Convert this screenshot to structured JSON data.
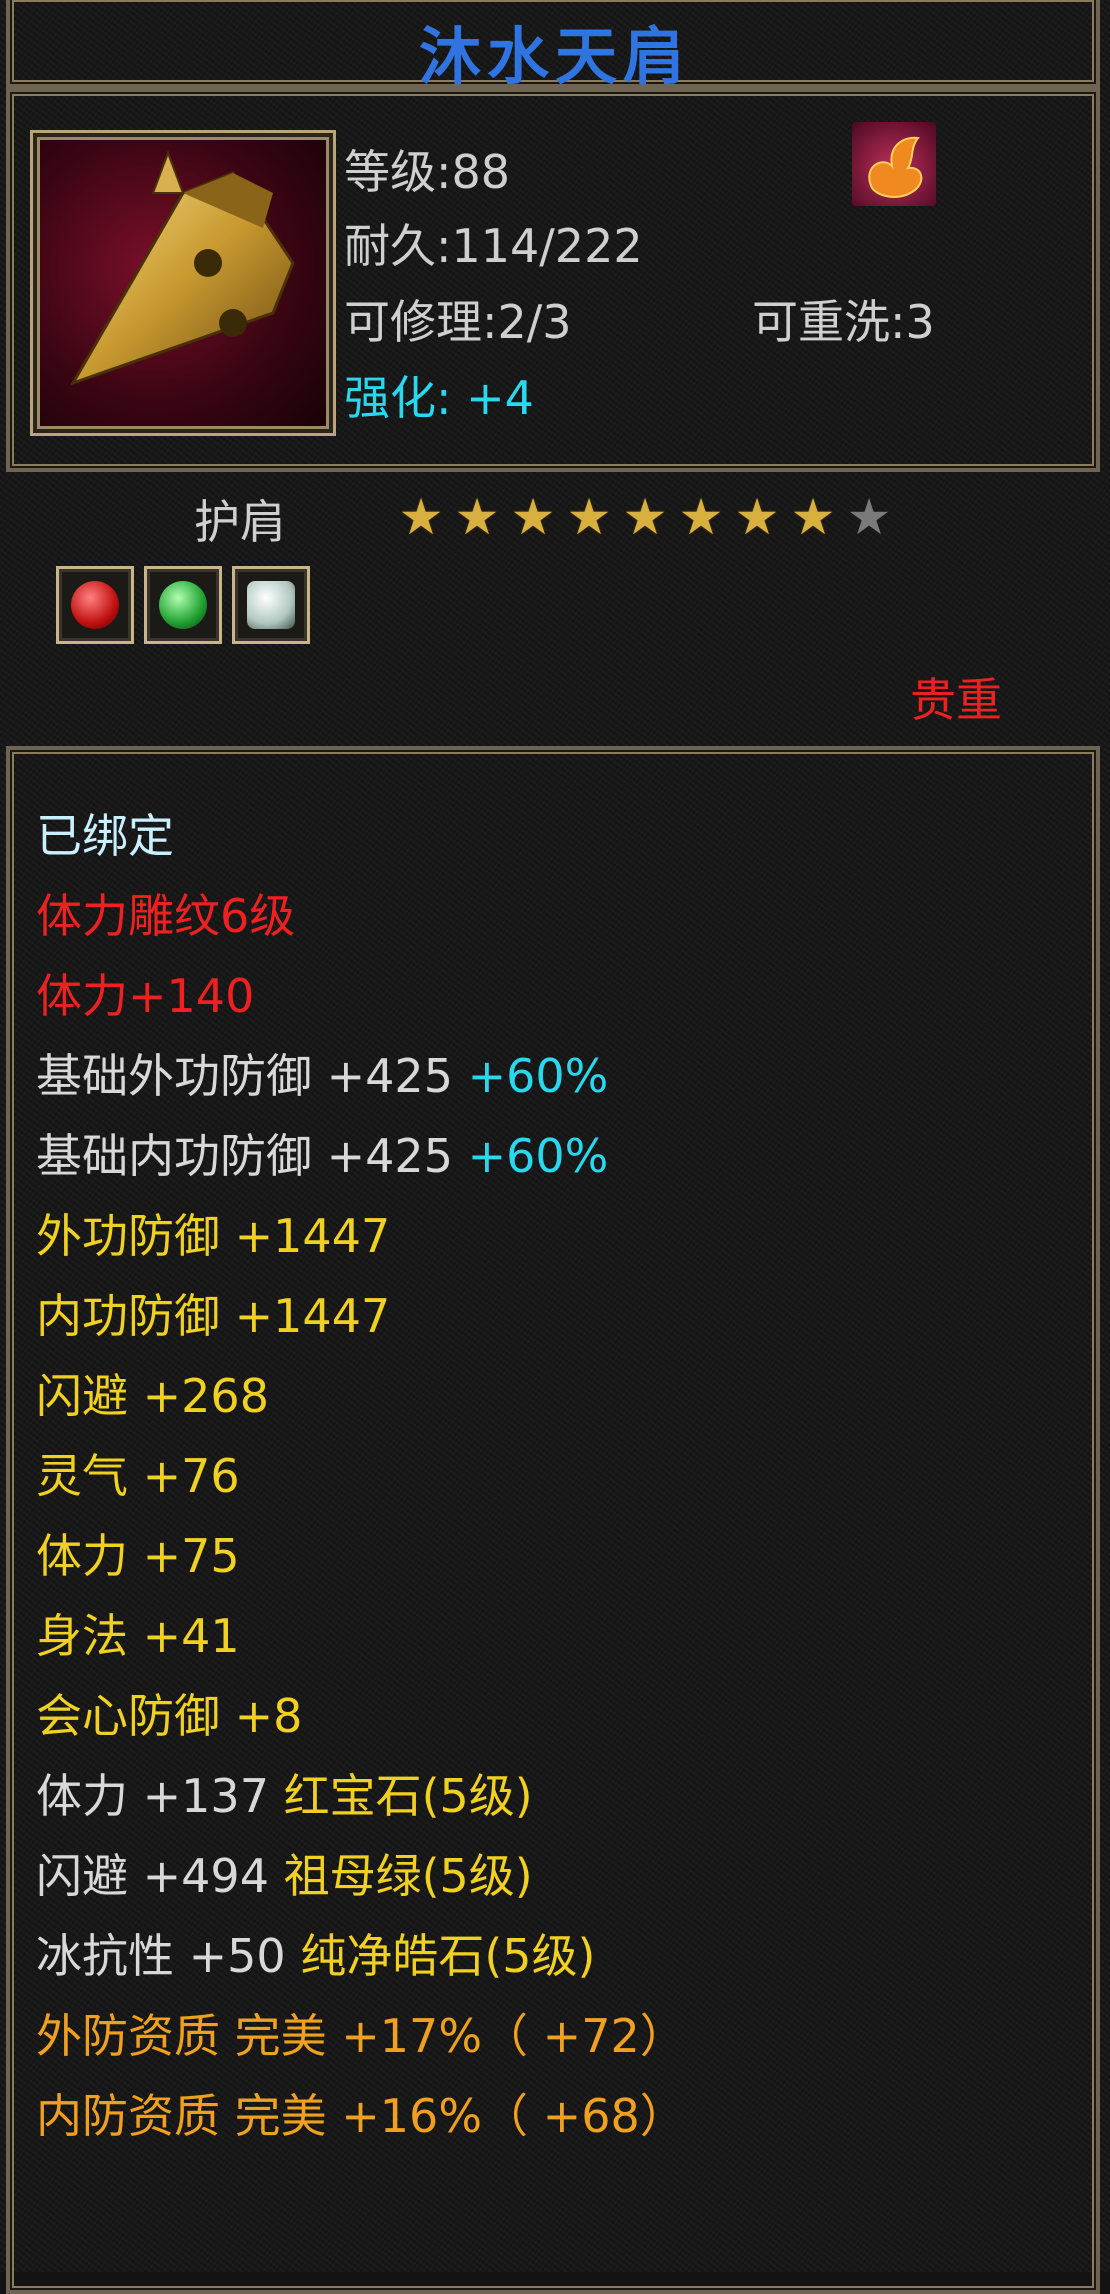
{
  "title": "沐水天肩",
  "info": {
    "level": "等级:88",
    "durability": "耐久:114/222",
    "repairable": "可修理:2/3",
    "rewashable": "可重洗:3",
    "enhance_label": "强化:",
    "enhance_value": "+4"
  },
  "item_type": "护肩",
  "stars": {
    "total": 9,
    "filled": 8
  },
  "rarity": "贵重",
  "gem_icons": [
    "ruby-gem",
    "emerald-gem",
    "diamond-gem"
  ],
  "colors": {
    "title": "#2f74e0",
    "enhance": "#28d8ee",
    "bound": "#c9f0ff",
    "red": "#ee2020",
    "yellow": "#f0d020",
    "orange": "#f0a020",
    "cyan": "#28d8ee",
    "white": "#d8d8d8"
  },
  "stats": {
    "bound": "已绑定",
    "carving": "体力雕纹6级",
    "carving_bonus": "体力+140",
    "base_ext_def": {
      "label": "基础外功防御 +425",
      "pct": "+60%"
    },
    "base_int_def": {
      "label": "基础内功防御 +425",
      "pct": "+60%"
    },
    "ext_def": "外功防御 +1447",
    "int_def": "内功防御 +1447",
    "dodge": "闪避 +268",
    "spirit": "灵气 +76",
    "stamina": "体力 +75",
    "agility": "身法 +41",
    "crit_def": "会心防御 +8",
    "gem1": {
      "stat": "体力 +137",
      "name": "红宝石(5级)"
    },
    "gem2": {
      "stat": "闪避 +494",
      "name": "祖母绿(5级)"
    },
    "gem3": {
      "stat": "冰抗性 +50",
      "name": "纯净皓石(5级)"
    },
    "quality1": "外防资质   完美 +17%（ +72）",
    "quality2": "内防资质   完美 +16%（ +68）"
  }
}
